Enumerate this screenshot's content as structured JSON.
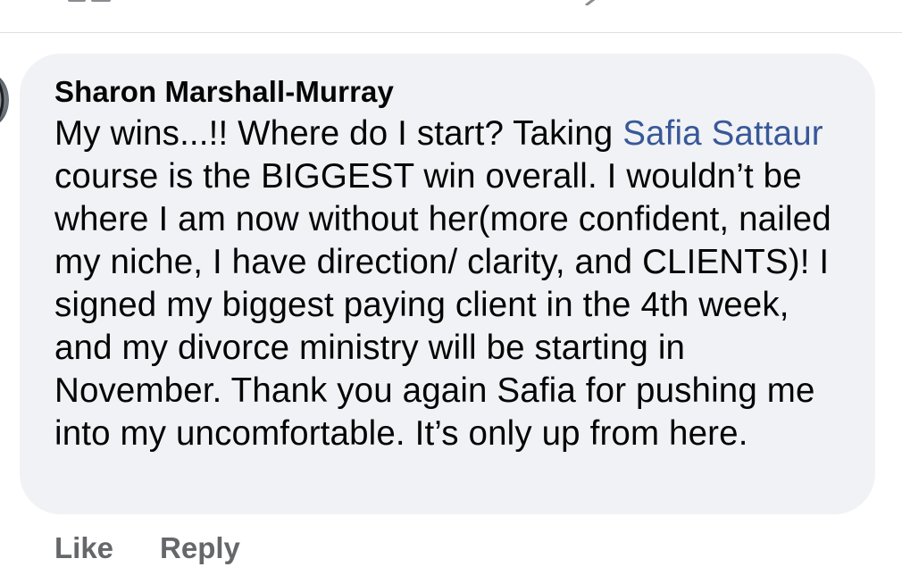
{
  "comment": {
    "author": "Sharon Marshall-Murray",
    "text_before_mention_1": "My wins...!! Where do I start? Taking ",
    "mention_1": "Safia",
    "mention_1b": "Sattaur",
    "text_after_mention": " course is the BIGGEST win overall. I wouldn’t be where I am now without her(more confident, nailed my niche, I have direction/ clarity, and CLIENTS)! I signed my biggest paying client in the 4th week, and my divorce ministry will be starting in November. Thank you again Safia for pushing me into my uncomfortable. It’s only up from here."
  },
  "actions": {
    "like_label": "Like",
    "reply_label": "Reply"
  },
  "icons": {
    "top_left": "toolbar-icon",
    "top_right": "chevron-icon",
    "avatar": "avatar"
  },
  "colors": {
    "bubble": "#f0f2f5",
    "mention": "#385898",
    "action": "#65676b",
    "text": "#050505"
  }
}
